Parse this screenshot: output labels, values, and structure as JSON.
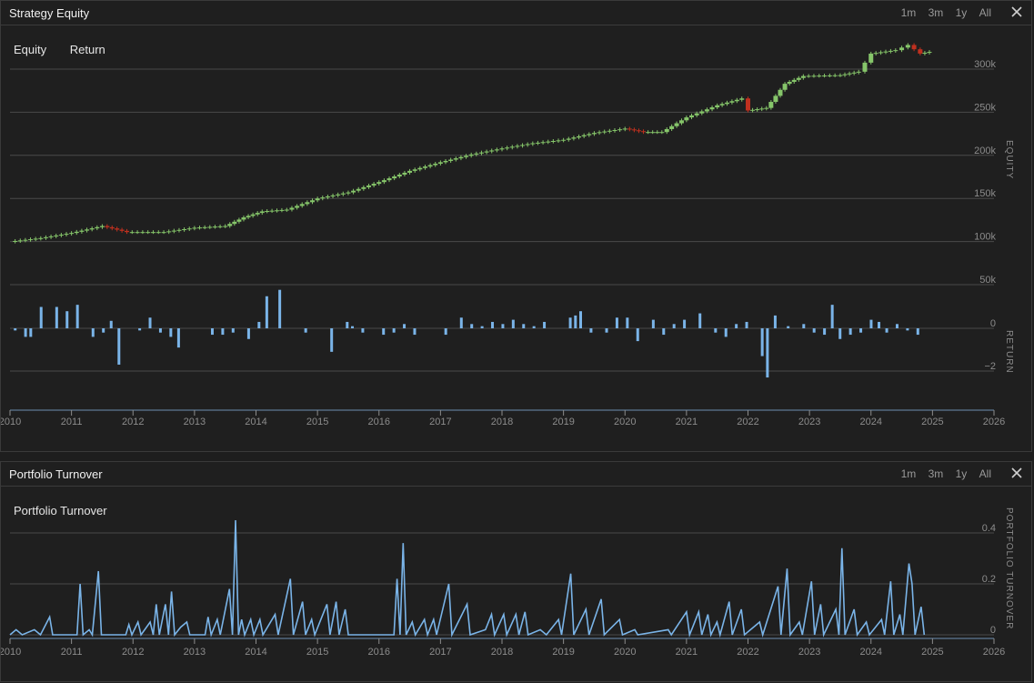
{
  "panels": {
    "equity": {
      "title": "Strategy Equity",
      "ranges": [
        "1m",
        "3m",
        "1y",
        "All"
      ],
      "legend": [
        "Equity",
        "Return"
      ],
      "ylabel_equity": "EQUITY",
      "ylabel_return": "RETURN"
    },
    "turnover": {
      "title": "Portfolio Turnover",
      "ranges": [
        "1m",
        "3m",
        "1y",
        "All"
      ],
      "legend": [
        "Portfolio Turnover"
      ],
      "ylabel": "PORTFOLIO TURNOVER"
    }
  },
  "colors": {
    "up": "#86c66a",
    "down": "#c0301f",
    "bar": "#7ab4e8",
    "grid": "#4a4a4a",
    "tick": "#8c8c8c"
  },
  "chart_data": [
    {
      "type": "candlestick",
      "title": "Strategy Equity",
      "ylabel": "EQUITY",
      "x_ticks": [
        "2010",
        "2011",
        "2012",
        "2013",
        "2014",
        "2015",
        "2016",
        "2017",
        "2018",
        "2019",
        "2020",
        "2021",
        "2022",
        "2023",
        "2024",
        "2025",
        "2026"
      ],
      "y_ticks": [
        "50k",
        "100k",
        "150k",
        "200k",
        "250k",
        "300k"
      ],
      "ylim": [
        50000,
        330000
      ],
      "series": [
        {
          "values": [
            [
              2010.0,
              100000
            ],
            [
              2010.5,
              104000
            ],
            [
              2011.0,
              110000
            ],
            [
              2011.5,
              118000
            ],
            [
              2011.9,
              111000
            ],
            [
              2012.5,
              111000
            ],
            [
              2013.0,
              116000
            ],
            [
              2013.5,
              118000
            ],
            [
              2013.8,
              128000
            ],
            [
              2014.1,
              135000
            ],
            [
              2014.5,
              137000
            ],
            [
              2015.0,
              150000
            ],
            [
              2015.5,
              157000
            ],
            [
              2016.0,
              169000
            ],
            [
              2016.5,
              182000
            ],
            [
              2017.0,
              192000
            ],
            [
              2017.5,
              201000
            ],
            [
              2018.0,
              208000
            ],
            [
              2018.5,
              214000
            ],
            [
              2019.0,
              218000
            ],
            [
              2019.5,
              226000
            ],
            [
              2020.0,
              231000
            ],
            [
              2020.3,
              227000
            ],
            [
              2020.6,
              227000
            ],
            [
              2021.0,
              244000
            ],
            [
              2021.5,
              258000
            ],
            [
              2021.9,
              266000
            ],
            [
              2022.0,
              252000
            ],
            [
              2022.3,
              255000
            ],
            [
              2022.6,
              283000
            ],
            [
              2022.9,
              292000
            ],
            [
              2023.5,
              293000
            ],
            [
              2023.8,
              297000
            ],
            [
              2024.0,
              318000
            ],
            [
              2024.4,
              322000
            ],
            [
              2024.6,
              328000
            ],
            [
              2024.8,
              318000
            ],
            [
              2024.95,
              320000
            ]
          ]
        }
      ]
    },
    {
      "type": "bar",
      "title": "Return",
      "ylabel": "RETURN",
      "y_ticks": [
        "0",
        "−2"
      ],
      "ylim": [
        -3,
        2.5
      ],
      "values": [
        [
          2010.1,
          -0.1
        ],
        [
          2010.3,
          -0.4
        ],
        [
          2010.4,
          -0.4
        ],
        [
          2010.6,
          1.0
        ],
        [
          2010.9,
          1.0
        ],
        [
          2011.1,
          0.8
        ],
        [
          2011.3,
          1.1
        ],
        [
          2011.6,
          -0.4
        ],
        [
          2011.8,
          -0.2
        ],
        [
          2011.95,
          0.35
        ],
        [
          2012.1,
          -1.7
        ],
        [
          2012.5,
          -0.1
        ],
        [
          2012.7,
          0.5
        ],
        [
          2012.9,
          -0.2
        ],
        [
          2013.1,
          -0.4
        ],
        [
          2013.25,
          -0.9
        ],
        [
          2013.9,
          -0.3
        ],
        [
          2014.1,
          -0.3
        ],
        [
          2014.3,
          -0.2
        ],
        [
          2014.6,
          -0.5
        ],
        [
          2014.8,
          0.3
        ],
        [
          2014.95,
          1.5
        ],
        [
          2015.2,
          1.8
        ],
        [
          2015.7,
          -0.2
        ],
        [
          2016.2,
          -1.1
        ],
        [
          2016.5,
          0.3
        ],
        [
          2016.6,
          0.1
        ],
        [
          2016.8,
          -0.2
        ],
        [
          2017.2,
          -0.3
        ],
        [
          2017.4,
          -0.2
        ],
        [
          2017.6,
          0.2
        ],
        [
          2017.8,
          -0.3
        ],
        [
          2018.4,
          -0.3
        ],
        [
          2018.7,
          0.5
        ],
        [
          2018.9,
          0.2
        ],
        [
          2019.1,
          0.1
        ],
        [
          2019.3,
          0.3
        ],
        [
          2019.5,
          0.2
        ],
        [
          2019.7,
          0.4
        ],
        [
          2019.9,
          0.2
        ],
        [
          2020.1,
          0.1
        ],
        [
          2020.3,
          0.3
        ],
        [
          2020.8,
          0.5
        ],
        [
          2020.9,
          0.6
        ],
        [
          2021.0,
          0.8
        ],
        [
          2021.2,
          -0.2
        ],
        [
          2021.5,
          -0.2
        ],
        [
          2021.7,
          0.5
        ],
        [
          2021.9,
          0.5
        ],
        [
          2022.1,
          -0.6
        ],
        [
          2022.4,
          0.4
        ],
        [
          2022.6,
          -0.3
        ],
        [
          2022.8,
          0.2
        ],
        [
          2023.0,
          0.4
        ],
        [
          2023.3,
          0.7
        ],
        [
          2023.6,
          -0.2
        ],
        [
          2023.8,
          -0.4
        ],
        [
          2024.0,
          0.2
        ],
        [
          2024.2,
          0.3
        ],
        [
          2024.5,
          -1.3
        ],
        [
          2024.6,
          -2.3
        ],
        [
          2024.75,
          0.6
        ],
        [
          2025.0,
          0.1
        ],
        [
          2025.3,
          0.2
        ],
        [
          2025.5,
          -0.2
        ],
        [
          2025.7,
          -0.3
        ],
        [
          2025.85,
          1.1
        ],
        [
          2026.0,
          -0.5
        ],
        [
          2026.2,
          -0.3
        ],
        [
          2026.4,
          -0.2
        ],
        [
          2026.6,
          0.4
        ],
        [
          2026.75,
          0.3
        ],
        [
          2026.9,
          -0.2
        ],
        [
          2027.1,
          0.2
        ],
        [
          2027.3,
          -0.1
        ],
        [
          2027.5,
          -0.3
        ]
      ]
    },
    {
      "type": "line",
      "title": "Portfolio Turnover",
      "ylabel": "PORTFOLIO TURNOVER",
      "x_ticks": [
        "2010",
        "2011",
        "2012",
        "2013",
        "2014",
        "2015",
        "2016",
        "2017",
        "2018",
        "2019",
        "2020",
        "2021",
        "2022",
        "2023",
        "2024",
        "2025",
        "2026"
      ],
      "y_ticks": [
        "0",
        "0.2",
        "0.4"
      ],
      "ylim": [
        0,
        0.48
      ],
      "values": [
        [
          2010.0,
          0.0
        ],
        [
          2010.1,
          0.02
        ],
        [
          2010.2,
          0.0
        ],
        [
          2010.4,
          0.02
        ],
        [
          2010.5,
          0.0
        ],
        [
          2010.65,
          0.07
        ],
        [
          2010.7,
          0.0
        ],
        [
          2011.1,
          0.0
        ],
        [
          2011.15,
          0.2
        ],
        [
          2011.2,
          0.0
        ],
        [
          2011.3,
          0.02
        ],
        [
          2011.35,
          0.0
        ],
        [
          2011.45,
          0.25
        ],
        [
          2011.5,
          0.0
        ],
        [
          2011.9,
          0.0
        ],
        [
          2011.95,
          0.04
        ],
        [
          2012.0,
          0.0
        ],
        [
          2012.1,
          0.05
        ],
        [
          2012.15,
          0.0
        ],
        [
          2012.3,
          0.05
        ],
        [
          2012.35,
          0.0
        ],
        [
          2012.4,
          0.12
        ],
        [
          2012.45,
          0.0
        ],
        [
          2012.55,
          0.12
        ],
        [
          2012.6,
          0.0
        ],
        [
          2012.65,
          0.17
        ],
        [
          2012.7,
          0.0
        ],
        [
          2012.8,
          0.03
        ],
        [
          2012.9,
          0.05
        ],
        [
          2012.95,
          0.0
        ],
        [
          2013.2,
          0.0
        ],
        [
          2013.25,
          0.07
        ],
        [
          2013.3,
          0.0
        ],
        [
          2013.4,
          0.06
        ],
        [
          2013.45,
          0.0
        ],
        [
          2013.6,
          0.18
        ],
        [
          2013.65,
          0.0
        ],
        [
          2013.7,
          0.45
        ],
        [
          2013.75,
          0.0
        ],
        [
          2013.8,
          0.06
        ],
        [
          2013.85,
          0.0
        ],
        [
          2013.95,
          0.06
        ],
        [
          2014.0,
          0.0
        ],
        [
          2014.1,
          0.06
        ],
        [
          2014.15,
          0.0
        ],
        [
          2014.35,
          0.08
        ],
        [
          2014.4,
          0.0
        ],
        [
          2014.6,
          0.22
        ],
        [
          2014.65,
          0.0
        ],
        [
          2014.8,
          0.13
        ],
        [
          2014.85,
          0.0
        ],
        [
          2014.95,
          0.06
        ],
        [
          2015.0,
          0.0
        ],
        [
          2015.1,
          0.06
        ],
        [
          2015.2,
          0.12
        ],
        [
          2015.25,
          0.0
        ],
        [
          2015.35,
          0.13
        ],
        [
          2015.4,
          0.0
        ],
        [
          2015.5,
          0.1
        ],
        [
          2015.55,
          0.0
        ],
        [
          2016.3,
          0.0
        ],
        [
          2016.35,
          0.22
        ],
        [
          2016.4,
          0.0
        ],
        [
          2016.45,
          0.36
        ],
        [
          2016.5,
          0.0
        ],
        [
          2016.6,
          0.05
        ],
        [
          2016.65,
          0.0
        ],
        [
          2016.8,
          0.06
        ],
        [
          2016.85,
          0.0
        ],
        [
          2016.95,
          0.06
        ],
        [
          2017.0,
          0.0
        ],
        [
          2017.2,
          0.2
        ],
        [
          2017.25,
          0.0
        ],
        [
          2017.5,
          0.12
        ],
        [
          2017.55,
          0.0
        ],
        [
          2017.8,
          0.02
        ],
        [
          2017.9,
          0.08
        ],
        [
          2017.95,
          0.0
        ],
        [
          2018.1,
          0.08
        ],
        [
          2018.15,
          0.0
        ],
        [
          2018.3,
          0.08
        ],
        [
          2018.35,
          0.0
        ],
        [
          2018.45,
          0.09
        ],
        [
          2018.5,
          0.0
        ],
        [
          2018.7,
          0.02
        ],
        [
          2018.8,
          0.0
        ],
        [
          2019.0,
          0.06
        ],
        [
          2019.05,
          0.0
        ],
        [
          2019.2,
          0.24
        ],
        [
          2019.25,
          0.0
        ],
        [
          2019.45,
          0.1
        ],
        [
          2019.5,
          0.0
        ],
        [
          2019.7,
          0.14
        ],
        [
          2019.75,
          0.0
        ],
        [
          2020.0,
          0.06
        ],
        [
          2020.05,
          0.0
        ],
        [
          2020.25,
          0.02
        ],
        [
          2020.3,
          0.0
        ],
        [
          2020.8,
          0.02
        ],
        [
          2020.85,
          0.0
        ],
        [
          2021.1,
          0.09
        ],
        [
          2021.15,
          0.0
        ],
        [
          2021.3,
          0.09
        ],
        [
          2021.35,
          0.0
        ],
        [
          2021.45,
          0.08
        ],
        [
          2021.5,
          0.0
        ],
        [
          2021.6,
          0.05
        ],
        [
          2021.65,
          0.0
        ],
        [
          2021.8,
          0.13
        ],
        [
          2021.85,
          0.0
        ],
        [
          2022.0,
          0.1
        ],
        [
          2022.05,
          0.0
        ],
        [
          2022.3,
          0.05
        ],
        [
          2022.35,
          0.0
        ],
        [
          2022.6,
          0.19
        ],
        [
          2022.65,
          0.0
        ],
        [
          2022.75,
          0.26
        ],
        [
          2022.8,
          0.0
        ],
        [
          2022.95,
          0.05
        ],
        [
          2023.0,
          0.0
        ],
        [
          2023.15,
          0.21
        ],
        [
          2023.2,
          0.0
        ],
        [
          2023.3,
          0.12
        ],
        [
          2023.35,
          0.0
        ],
        [
          2023.55,
          0.1
        ],
        [
          2023.6,
          0.0
        ],
        [
          2023.65,
          0.34
        ],
        [
          2023.7,
          0.0
        ],
        [
          2023.85,
          0.1
        ],
        [
          2023.9,
          0.0
        ],
        [
          2024.05,
          0.05
        ],
        [
          2024.1,
          0.0
        ],
        [
          2024.3,
          0.06
        ],
        [
          2024.35,
          0.0
        ],
        [
          2024.45,
          0.21
        ],
        [
          2024.5,
          0.0
        ],
        [
          2024.6,
          0.08
        ],
        [
          2024.65,
          0.0
        ],
        [
          2024.75,
          0.28
        ],
        [
          2024.8,
          0.2
        ],
        [
          2024.85,
          0.0
        ],
        [
          2024.95,
          0.11
        ],
        [
          2025.0,
          0.0
        ]
      ]
    }
  ]
}
